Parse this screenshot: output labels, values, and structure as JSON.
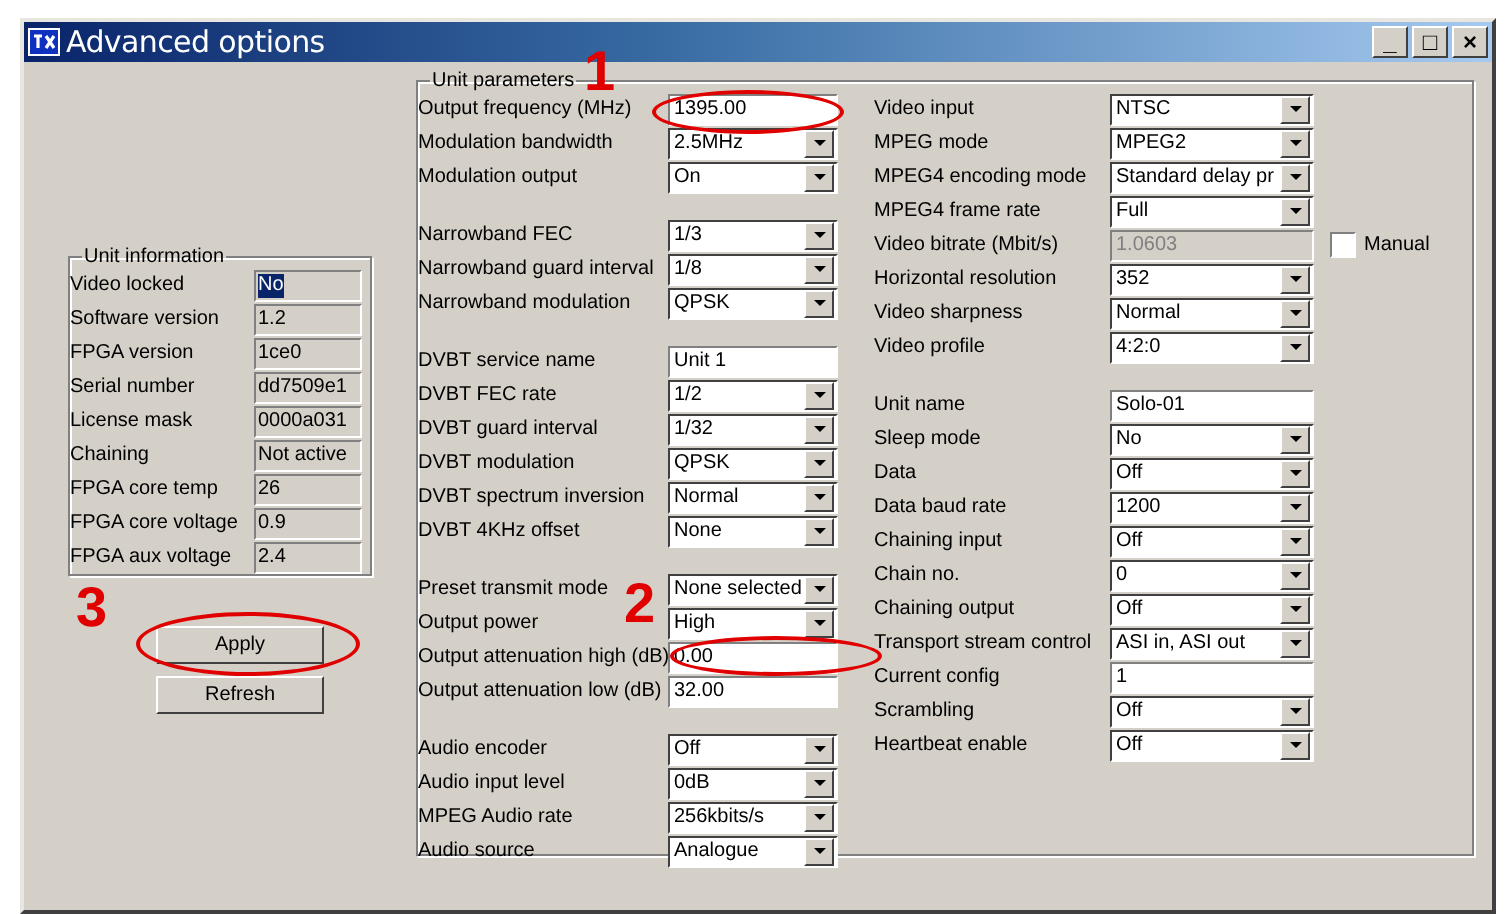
{
  "window": {
    "title": "Advanced options",
    "controls": [
      "_",
      "□",
      "×"
    ]
  },
  "unit_information": {
    "title": "Unit information",
    "rows": [
      {
        "label": "Video locked",
        "value": "No",
        "selected": true
      },
      {
        "label": "Software version",
        "value": "1.2",
        "selected": false
      },
      {
        "label": "FPGA version",
        "value": "1ce0",
        "selected": false
      },
      {
        "label": "Serial number",
        "value": "dd7509e1",
        "selected": false
      },
      {
        "label": "License mask",
        "value": "0000a031",
        "selected": false
      },
      {
        "label": "Chaining",
        "value": "Not active",
        "selected": false
      },
      {
        "label": "FPGA core temp",
        "value": "26",
        "selected": false
      },
      {
        "label": "FPGA core voltage",
        "value": "0.9",
        "selected": false
      },
      {
        "label": "FPGA aux voltage",
        "value": "2.4",
        "selected": false
      }
    ]
  },
  "buttons": [
    "Apply",
    "Refresh"
  ],
  "unit_parameters": {
    "title": "Unit parameters",
    "columns": [
      {
        "groups": [
          {
            "rows": [
              {
                "label": "Output frequency (MHz)",
                "kind": "text",
                "value": "1395.00"
              },
              {
                "label": "Modulation bandwidth",
                "kind": "dropdown",
                "value": "2.5MHz"
              },
              {
                "label": "Modulation output",
                "kind": "dropdown",
                "value": "On"
              }
            ]
          },
          {
            "rows": [
              {
                "label": "Narrowband FEC",
                "kind": "dropdown",
                "value": "1/3"
              },
              {
                "label": "Narrowband guard interval",
                "kind": "dropdown",
                "value": "1/8"
              },
              {
                "label": "Narrowband modulation",
                "kind": "dropdown",
                "value": "QPSK"
              }
            ]
          },
          {
            "rows": [
              {
                "label": "DVBT service name",
                "kind": "text",
                "value": "Unit 1"
              },
              {
                "label": "DVBT FEC rate",
                "kind": "dropdown",
                "value": "1/2"
              },
              {
                "label": "DVBT guard interval",
                "kind": "dropdown",
                "value": "1/32"
              },
              {
                "label": "DVBT modulation",
                "kind": "dropdown",
                "value": "QPSK"
              },
              {
                "label": "DVBT spectrum inversion",
                "kind": "dropdown",
                "value": "Normal"
              },
              {
                "label": "DVBT 4KHz offset",
                "kind": "dropdown",
                "value": "None"
              }
            ]
          },
          {
            "rows": [
              {
                "label": "Preset transmit mode",
                "kind": "dropdown",
                "value": "None selected"
              },
              {
                "label": "Output power",
                "kind": "dropdown",
                "value": "High"
              },
              {
                "label": "Output attenuation high (dB)",
                "kind": "text",
                "value": "0.00"
              },
              {
                "label": "Output attenuation low (dB)",
                "kind": "text",
                "value": "32.00"
              }
            ]
          },
          {
            "rows": [
              {
                "label": "Audio encoder",
                "kind": "dropdown",
                "value": "Off"
              },
              {
                "label": "Audio input level",
                "kind": "dropdown",
                "value": "0dB"
              },
              {
                "label": "MPEG Audio rate",
                "kind": "dropdown",
                "value": "256kbits/s"
              },
              {
                "label": "Audio source",
                "kind": "dropdown",
                "value": "Analogue"
              }
            ]
          }
        ]
      },
      {
        "groups": [
          {
            "rows": [
              {
                "label": "Video input",
                "kind": "dropdown",
                "value": "NTSC"
              },
              {
                "label": "MPEG mode",
                "kind": "dropdown",
                "value": "MPEG2"
              },
              {
                "label": "MPEG4 encoding mode",
                "kind": "dropdown",
                "value": "Standard delay pr"
              },
              {
                "label": "MPEG4 frame rate",
                "kind": "dropdown",
                "value": "Full"
              },
              {
                "label": "Video bitrate (Mbit/s)",
                "kind": "disabled-text",
                "value": "1.0603",
                "checkbox": {
                  "label": "Manual",
                  "checked": false
                }
              },
              {
                "label": "Horizontal resolution",
                "kind": "dropdown",
                "value": "352"
              },
              {
                "label": "Video sharpness",
                "kind": "dropdown",
                "value": "Normal"
              },
              {
                "label": "Video profile",
                "kind": "dropdown",
                "value": "4:2:0"
              }
            ]
          },
          {
            "rows": [
              {
                "label": "Unit name",
                "kind": "text",
                "value": "Solo-01"
              },
              {
                "label": "Sleep mode",
                "kind": "dropdown",
                "value": "No"
              },
              {
                "label": "Data",
                "kind": "dropdown",
                "value": "Off"
              },
              {
                "label": "Data baud rate",
                "kind": "dropdown",
                "value": "1200"
              },
              {
                "label": "Chaining input",
                "kind": "dropdown",
                "value": "Off"
              },
              {
                "label": "Chain no.",
                "kind": "dropdown",
                "value": "0"
              },
              {
                "label": "Chaining output",
                "kind": "dropdown",
                "value": "Off"
              },
              {
                "label": "Transport stream control",
                "kind": "dropdown",
                "value": "ASI in, ASI out"
              },
              {
                "label": "Current config",
                "kind": "text",
                "value": "1"
              },
              {
                "label": "Scrambling",
                "kind": "dropdown",
                "value": "Off"
              },
              {
                "label": "Heartbeat enable",
                "kind": "dropdown",
                "value": "Off"
              }
            ]
          }
        ]
      }
    ]
  },
  "annotations": [
    {
      "label": "1"
    },
    {
      "label": "2"
    },
    {
      "label": "3"
    }
  ]
}
